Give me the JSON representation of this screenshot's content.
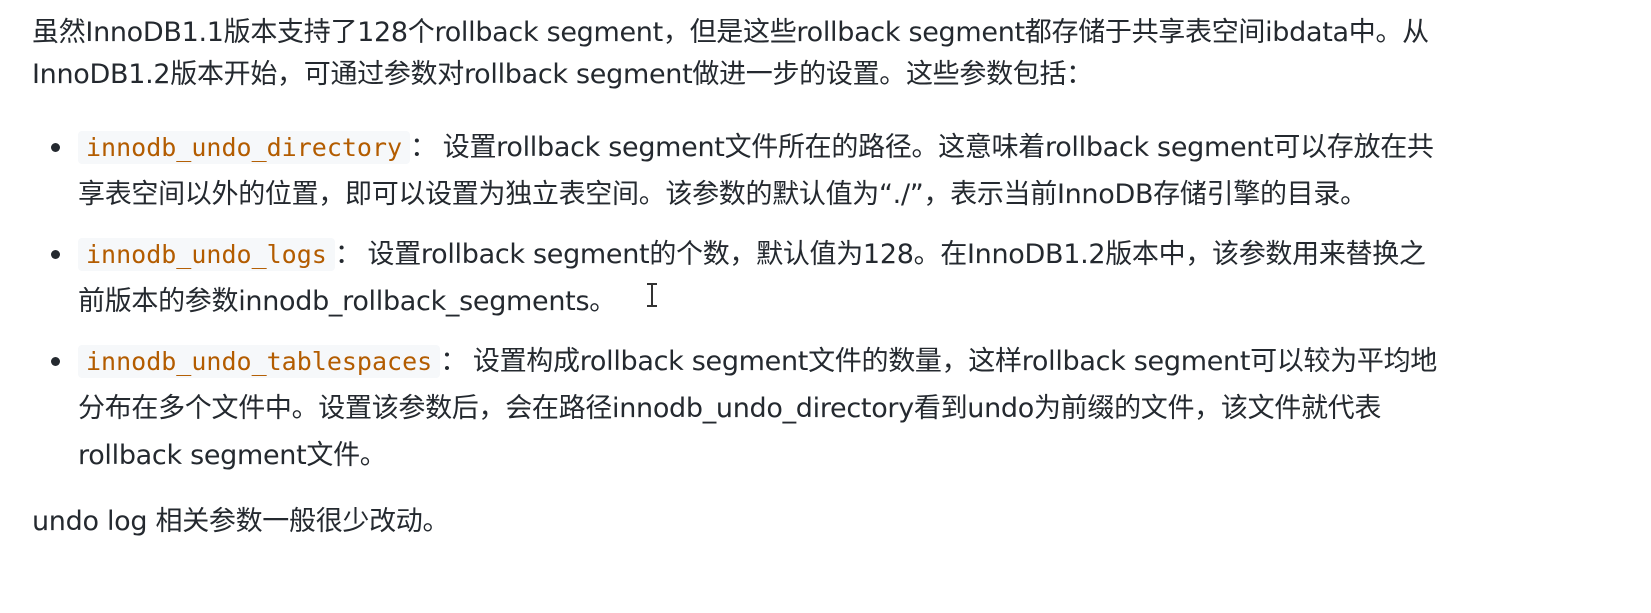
{
  "intro": {
    "line1": "虽然InnoDB1.1版本支持了128个rollback segment，但是这些rollback segment都存储于共享表空间ibdata中。从",
    "line2": "InnoDB1.2版本开始，可通过参数对rollback segment做进一步的设置。这些参数包括："
  },
  "params": [
    {
      "name": "innodb_undo_directory",
      "sep": "：",
      "line1": "设置rollback segment文件所在的路径。这意味着rollback segment可以存放在共",
      "line2": "享表空间以外的位置，即可以设置为独立表空间。该参数的默认值为“./”，表示当前InnoDB存储引擎的目录。",
      "line3": ""
    },
    {
      "name": "innodb_undo_logs",
      "sep": "：",
      "line1": "设置rollback segment的个数，默认值为128。在InnoDB1.2版本中，该参数用来替换之",
      "line2": "前版本的参数innodb_rollback_segments。",
      "line3": ""
    },
    {
      "name": "innodb_undo_tablespaces",
      "sep": "：",
      "line1": "设置构成rollback segment文件的数量，这样rollback segment可以较为平均地",
      "line2": "分布在多个文件中。设置该参数后，会在路径innodb_undo_directory看到undo为前缀的文件，该文件就代表",
      "line3": "rollback segment文件。"
    }
  ],
  "closing": "undo log 相关参数一般很少改动。"
}
